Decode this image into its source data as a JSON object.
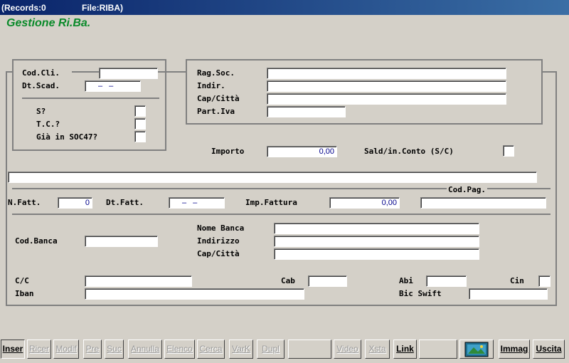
{
  "window": {
    "records": "(Records:0",
    "file": "File:RIBA)"
  },
  "app_title": "Gestione Ri.Ba.",
  "client": {
    "cod_cli_label": "Cod.Cli.",
    "cod_cli_value": "",
    "dt_scad_label": "Dt.Scad.",
    "dt_scad_value": "– –",
    "s_label": "S?",
    "tc_label": "T.C.?",
    "soc47_label": "Già in SOC47?"
  },
  "company": {
    "rag_soc_label": "Rag.Soc.",
    "indir_label": "Indir.",
    "cap_citta_label": "Cap/Città",
    "part_iva_label": "Part.Iva"
  },
  "importo": {
    "label": "Importo",
    "value": "0,00",
    "sald_label": "Sald/in.Conto (S/C)"
  },
  "invoice": {
    "cod_pag_label": "Cod.Pag.",
    "n_fatt_label": "N.Fatt.",
    "n_fatt_value": "0",
    "dt_fatt_label": "Dt.Fatt.",
    "dt_fatt_value": "– –",
    "imp_fattura_label": "Imp.Fattura",
    "imp_fattura_value": "0,00"
  },
  "bank": {
    "cod_banca_label": "Cod.Banca",
    "nome_banca_label": "Nome Banca",
    "indirizzo_label": "Indirizzo",
    "cap_citta_label": "Cap/Città",
    "cc_label": "C/C",
    "cab_label": "Cab",
    "abi_label": "Abi",
    "cin_label": "Cin",
    "iban_label": "Iban",
    "bic_label": "Bic Swift"
  },
  "buttons": [
    "Inser",
    "Ricer",
    "Modif",
    "Pre",
    "Suc",
    "Annulla",
    "Elenco",
    "Cerca",
    "VarK",
    "Dupl",
    "",
    "Video",
    "Xsta",
    "Link",
    "",
    "",
    "Immag",
    "Uscita"
  ]
}
